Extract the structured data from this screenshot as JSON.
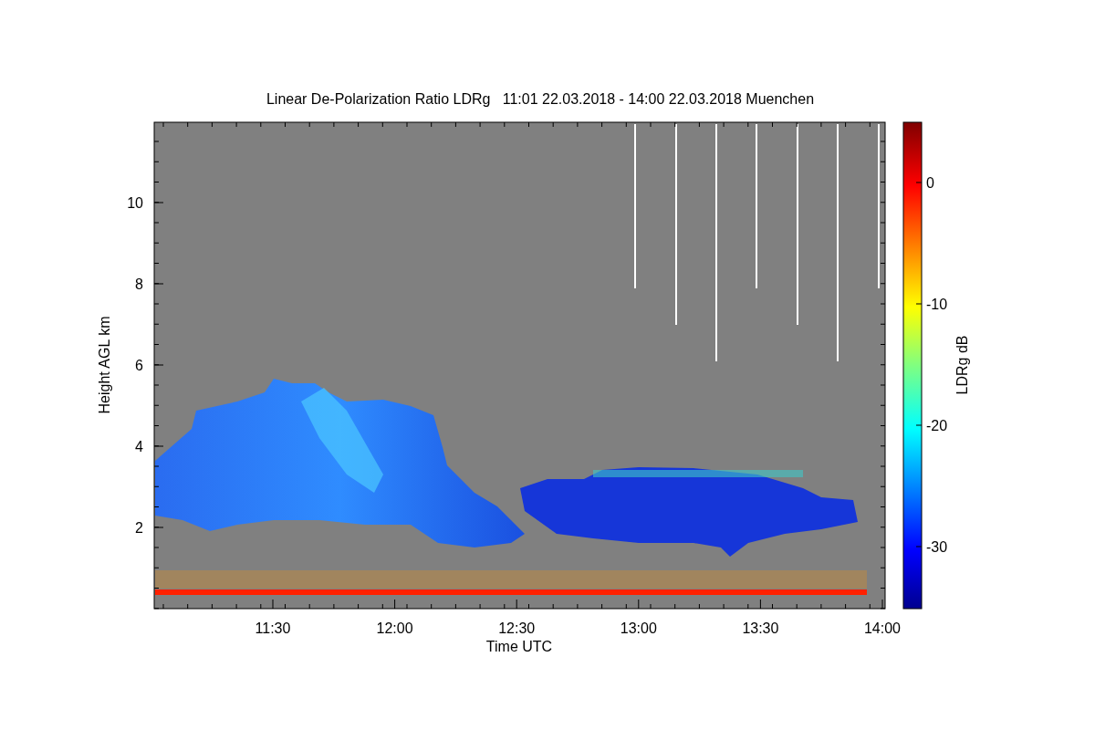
{
  "title": "Linear De-Polarization Ratio LDRg   11:01 22.03.2018 - 14:00 22.03.2018 Muenchen",
  "x_axis": {
    "label": "Time UTC",
    "ticks": [
      "11:30",
      "12:00",
      "12:30",
      "13:00",
      "13:30",
      "14:00"
    ]
  },
  "y_axis": {
    "label": "Height AGL km",
    "ticks": [
      "10",
      "8",
      "6",
      "4",
      "2"
    ]
  },
  "colorbar": {
    "label": "LDRg dB",
    "ticks": [
      "0",
      "-10",
      "-20",
      "-30"
    ]
  }
}
